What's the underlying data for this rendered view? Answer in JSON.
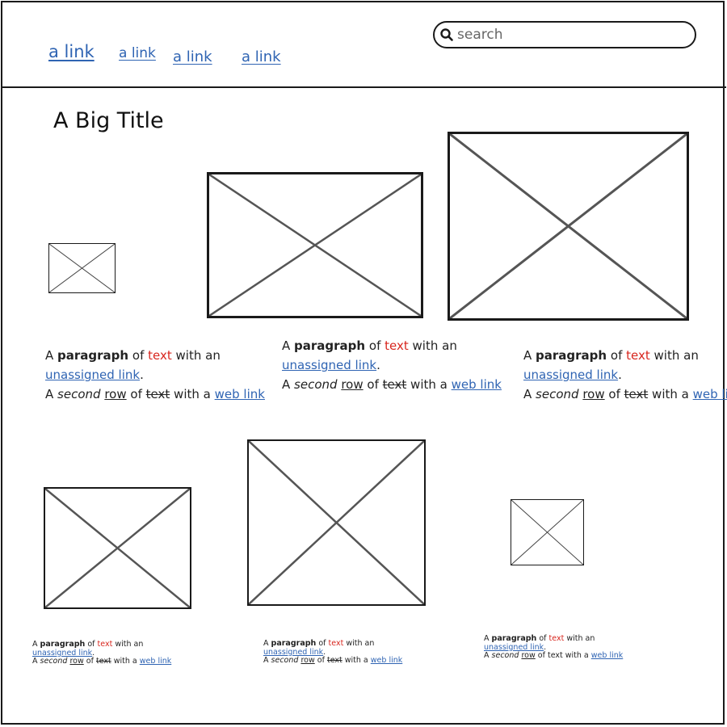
{
  "nav": {
    "links": [
      "a link",
      "a link",
      "a link",
      "a link"
    ]
  },
  "search": {
    "placeholder": "search"
  },
  "main": {
    "title": "A Big Title"
  },
  "paragraphs": [
    {
      "intro": "A",
      "bold": "paragraph",
      "of": "of",
      "red": "text",
      "with_an": "with an",
      "link1": "unassigned link",
      "period": ".",
      "row2_a": "A",
      "italic": "second",
      "underline": "row",
      "of2": "of",
      "strike": "text",
      "with_a": "with a",
      "link2": "web link"
    },
    {
      "intro": "A",
      "bold": "paragraph",
      "of": "of",
      "red": "text",
      "with_an": "with an",
      "link1": "unassigned link",
      "period": ".",
      "row2_a": "A",
      "italic": "second",
      "underline": "row",
      "of2": "of",
      "strike": "text",
      "with_a": "with a",
      "link2": "web link"
    },
    {
      "intro": "A",
      "bold": "paragraph",
      "of": "of",
      "red": "text",
      "with_an": "with an",
      "link1": "unassigned link",
      "period": ".",
      "row2_a": "A",
      "italic": "second",
      "underline": "row",
      "of2": "of",
      "strike": "text",
      "with_a": "with a",
      "link2": "web link"
    },
    {
      "intro": "A",
      "bold": "paragraph",
      "of": "of",
      "red": "text",
      "with_an": "with an",
      "link1": "unassigned link",
      "period": ".",
      "row2_a": "A",
      "italic": "second",
      "underline": "row",
      "of2": "of",
      "strike": "text",
      "with_a": "with a",
      "link2": "web link"
    },
    {
      "intro": "A",
      "bold": "paragraph",
      "of": "of",
      "red": "text",
      "with_an": "with an",
      "link1": "unassigned link",
      "period": ".",
      "row2_a": "A",
      "italic": "second",
      "underline": "row",
      "of2": "of",
      "strike": "text",
      "with_a": "with a",
      "link2": "web link"
    },
    {
      "intro": "A",
      "bold": "paragraph",
      "of": "of",
      "red": "text",
      "with_an": "with an",
      "link1": "unassigned link",
      "period": ".",
      "row2_a": "A",
      "italic": "second",
      "underline": "row",
      "of2": "of",
      "strike": "text",
      "with_a": "with a",
      "link2": "web link"
    }
  ],
  "colors": {
    "link": "#2f64b3",
    "red_text": "#d8261e",
    "border": "#1a1a1a"
  },
  "icons": {
    "search": "search-icon",
    "placeholder": "image-placeholder-icon"
  }
}
